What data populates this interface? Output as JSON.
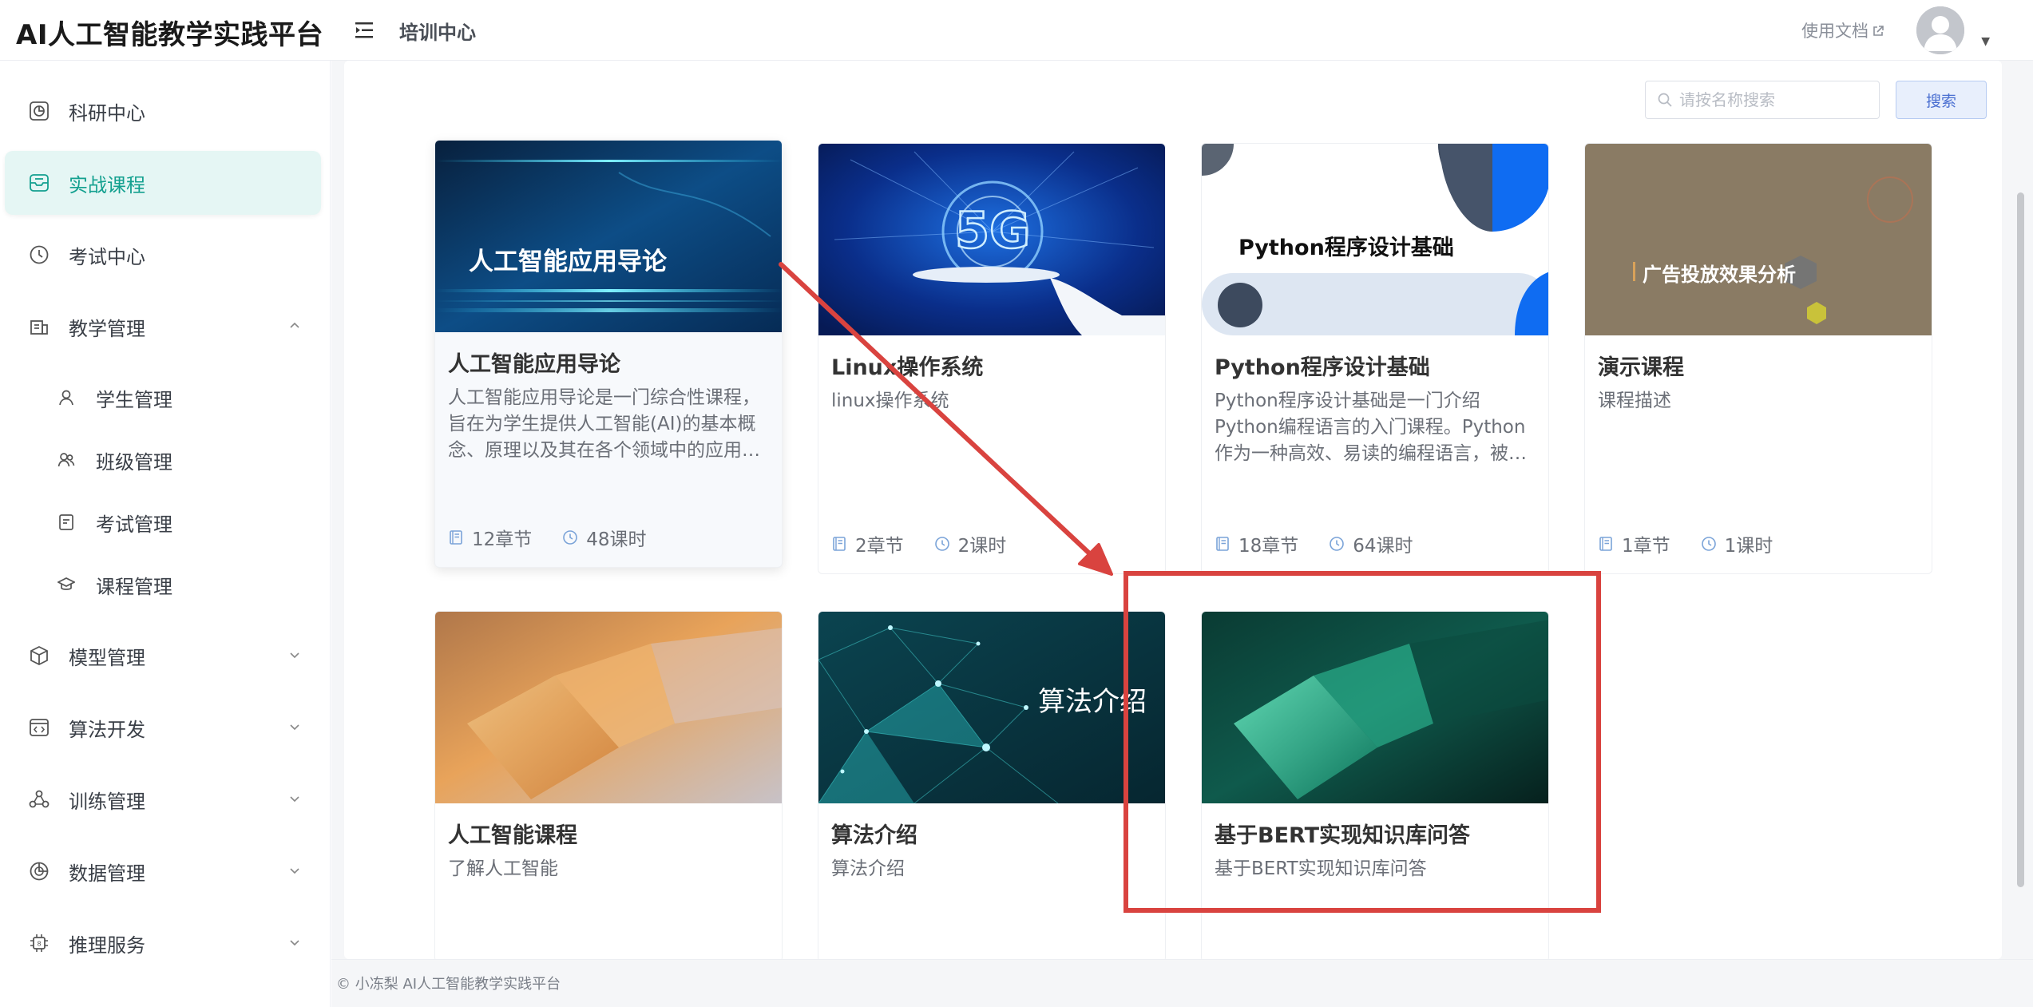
{
  "header": {
    "logo": "AI人工智能教学实践平台",
    "breadcrumb": "培训中心",
    "doc_link": "使用文档"
  },
  "sidebar": {
    "items": [
      {
        "label": "科研中心",
        "icon": "pie-chart-icon"
      },
      {
        "label": "实战课程",
        "icon": "inbox-icon",
        "active": true
      },
      {
        "label": "考试中心",
        "icon": "clock-icon"
      },
      {
        "label": "教学管理",
        "icon": "building-icon",
        "expanded": true
      },
      {
        "label": "学生管理",
        "icon": "user-icon",
        "sub": true
      },
      {
        "label": "班级管理",
        "icon": "users-icon",
        "sub": true
      },
      {
        "label": "考试管理",
        "icon": "document-icon",
        "sub": true
      },
      {
        "label": "课程管理",
        "icon": "mortarboard-icon",
        "sub": true
      },
      {
        "label": "模型管理",
        "icon": "cube-icon"
      },
      {
        "label": "算法开发",
        "icon": "code-window-icon"
      },
      {
        "label": "训练管理",
        "icon": "cluster-icon"
      },
      {
        "label": "数据管理",
        "icon": "database-icon"
      },
      {
        "label": "推理服务",
        "icon": "chip-icon"
      }
    ]
  },
  "search": {
    "placeholder": "请按名称搜索",
    "button": "搜索"
  },
  "courses": [
    {
      "title": "人工智能应用导论",
      "cover_text": "人工智能应用导论",
      "desc": "人工智能应用导论是一门综合性课程，旨在为学生提供人工智能(AI)的基本概念、原理以及其在各个领域中的应用知识。",
      "chapters": "12章节",
      "hours": "48课时"
    },
    {
      "title": "Linux操作系统",
      "cover_text": "",
      "desc": "linux操作系统",
      "chapters": "2章节",
      "hours": "2课时"
    },
    {
      "title": "Python程序设计基础",
      "cover_text": "Python程序设计基础",
      "desc": "Python程序设计基础是一门介绍Python编程语言的入门课程。Python作为一种高效、易读的编程语言，被广泛应用。",
      "chapters": "18章节",
      "hours": "64课时"
    },
    {
      "title": "演示课程",
      "cover_text": "广告投放效果分析",
      "desc": "课程描述",
      "chapters": "1章节",
      "hours": "1课时"
    },
    {
      "title": "人工智能课程",
      "cover_text": "",
      "desc": "了解人工智能",
      "chapters": "",
      "hours": ""
    },
    {
      "title": "算法介绍",
      "cover_text": "算法介绍",
      "desc": "算法介绍",
      "chapters": "",
      "hours": ""
    },
    {
      "title": "基于BERT实现知识库问答",
      "cover_text": "",
      "desc": "基于BERT实现知识库问答",
      "chapters": "",
      "hours": ""
    }
  ],
  "footer": "© 小冻梨 AI人工智能教学实践平台",
  "colors": {
    "accent": "#13a08f",
    "active_bg": "#e5f6f4",
    "annotation": "#d9433f"
  }
}
